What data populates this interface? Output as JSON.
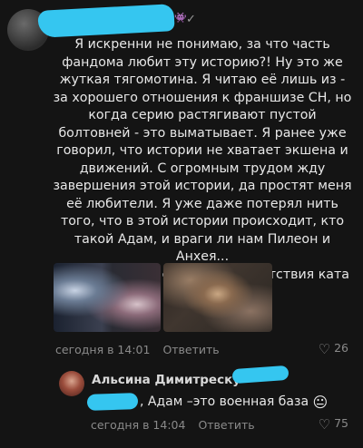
{
  "comment": {
    "text": "Я искренни не понимаю, за что часть фандома любит эту историю?! Ну это же жуткая тягомотина. Я читаю её лишь из - за хорошего отношения к франшизе СН, но когда серию растягивают пустой болтовней - это выматывает. Я ранее уже говорил, что истории не хватает экшена и движений. С огромным трудом жду завершения этой истории, да простят меня её любители. Я уже даже потерял нить того, что в этой истории происходит, кто такой Адам, и враги ли нам Пилеон и Анхея...\nСпасибо за кат с Димой, и отсутствия ката с Борей",
    "emoji": "🤪",
    "time": "сегодня в 14:01",
    "reply_label": "Ответить",
    "likes": "26"
  },
  "reply": {
    "author": "Альсина Димитреску",
    "text": ", Адам –это военная база",
    "emoji": "😐",
    "time": "сегодня в 14:04",
    "reply_label": "Ответить",
    "likes": "75"
  },
  "icons": {
    "heart": "heart-outline-icon",
    "check": "check-icon"
  },
  "colors": {
    "background": "#141414",
    "redaction": "#35c6f0",
    "meta_text": "#8a8a8a"
  }
}
